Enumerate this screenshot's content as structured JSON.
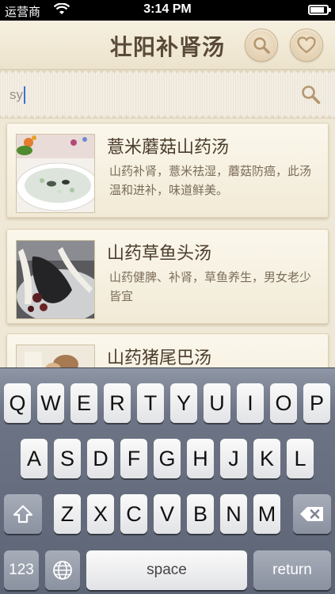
{
  "status_bar": {
    "carrier": "运营商",
    "time": "3:14 PM",
    "battery_level": 0.85
  },
  "nav": {
    "title": "壮阳补肾汤",
    "search_icon": "search-icon",
    "favorite_icon": "heart-icon"
  },
  "search": {
    "value": "sy",
    "icon": "search-icon"
  },
  "recipes": [
    {
      "title": "薏米蘑菇山药汤",
      "description": "山药补肾，薏米祛湿，蘑菇防癌，此汤温和进补，味道鲜美。"
    },
    {
      "title": "山药草鱼头汤",
      "description": "山药健脾、补肾，草鱼养生，男女老少皆宜"
    },
    {
      "title": "山药猪尾巴汤",
      "description": ""
    }
  ],
  "keyboard": {
    "row1": [
      "Q",
      "W",
      "E",
      "R",
      "T",
      "Y",
      "U",
      "I",
      "O",
      "P"
    ],
    "row2": [
      "A",
      "S",
      "D",
      "F",
      "G",
      "H",
      "J",
      "K",
      "L"
    ],
    "row3": [
      "Z",
      "X",
      "C",
      "V",
      "B",
      "N",
      "M"
    ],
    "shift_icon": "shift-icon",
    "delete_icon": "delete-icon",
    "numbers_label": "123",
    "globe_icon": "globe-icon",
    "space_label": "space",
    "return_label": "return"
  }
}
